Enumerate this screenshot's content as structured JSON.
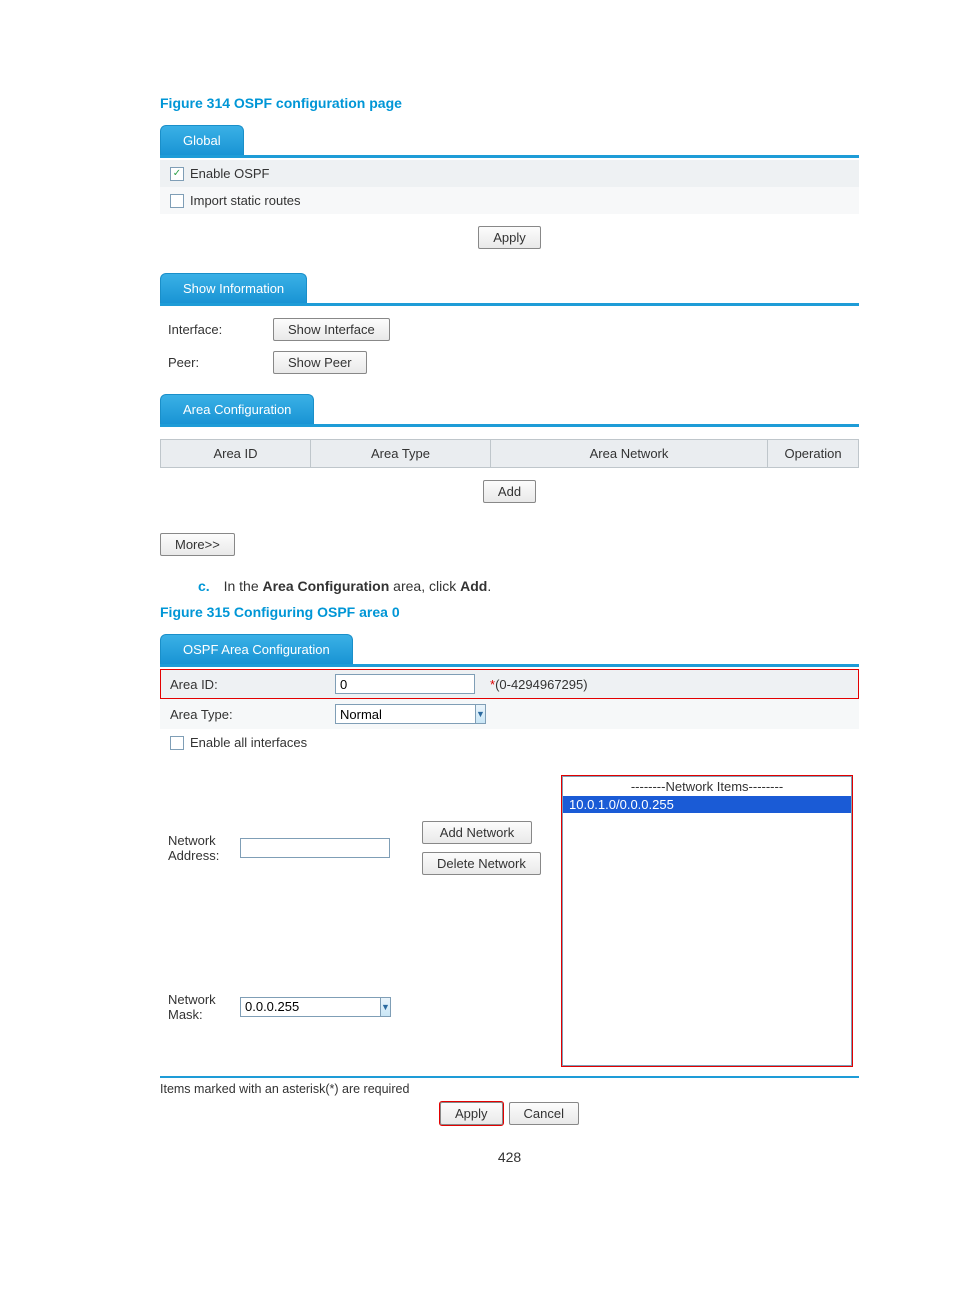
{
  "fig314": {
    "caption": "Figure 314 OSPF configuration page",
    "tab_global": "Global",
    "enable_ospf": "Enable OSPF",
    "import_static": "Import static routes",
    "apply": "Apply",
    "tab_show_info": "Show Information",
    "interface_label": "Interface:",
    "show_interface_btn": "Show Interface",
    "peer_label": "Peer:",
    "show_peer_btn": "Show Peer",
    "tab_area_cfg": "Area Configuration",
    "th_area_id": "Area ID",
    "th_area_type": "Area Type",
    "th_area_network": "Area Network",
    "th_operation": "Operation",
    "add_btn": "Add",
    "more_btn": "More>>"
  },
  "step": {
    "letter": "c.",
    "text_pre": "In the ",
    "bold1": "Area Configuration",
    "text_mid": " area, click ",
    "bold2": "Add",
    "text_post": "."
  },
  "fig315": {
    "caption": "Figure 315 Configuring OSPF area 0",
    "tab": "OSPF Area Configuration",
    "area_id_label": "Area ID:",
    "area_id_value": "0",
    "area_id_hint": "(0-4294967295)",
    "area_type_label": "Area Type:",
    "area_type_value": "Normal",
    "enable_all_if": "Enable all interfaces",
    "net_addr_label": "Network Address:",
    "net_mask_label": "Network Mask:",
    "net_mask_value": "0.0.0.255",
    "add_net_btn": "Add Network",
    "del_net_btn": "Delete Network",
    "list_header": "--------Network Items--------",
    "list_item": "10.0.1.0/0.0.0.255",
    "footnote": "Items marked with an asterisk(*) are required",
    "apply": "Apply",
    "cancel": "Cancel"
  },
  "page_no": "428"
}
